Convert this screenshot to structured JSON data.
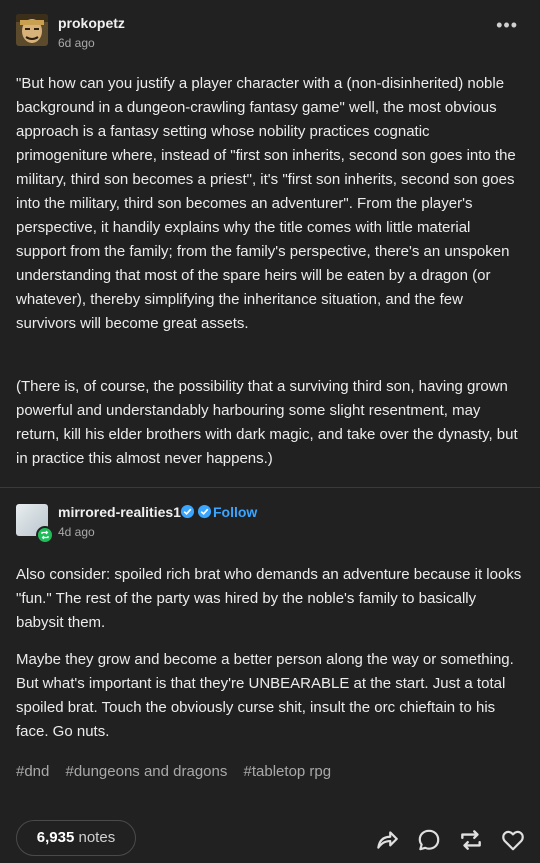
{
  "post": {
    "username": "prokopetz",
    "time": "6d ago",
    "paragraphs": [
      "\"But how can you justify a player character with a (non-disinherited) noble background in a dungeon-crawling fantasy game\" well, the most obvious approach is a fantasy setting whose nobility practices cognatic primogeniture where, instead of \"first son inherits, second son goes into the military, third son becomes a priest\", it's \"first son inherits, second son goes into the military, third son becomes an adventurer\". From the player's perspective, it handily explains why the title comes with little material support from the family; from the family's perspective, there's an unspoken understanding that most of the spare heirs will be eaten by a dragon (or whatever), thereby simplifying the inheritance situation, and the few survivors will become great assets.",
      "(There is, of course, the possibility that a surviving third son, having grown powerful and understandably harbouring some slight resentment, may return, kill his elder brothers with dark magic, and take over the dynasty, but in practice this almost never happens.)"
    ]
  },
  "reblog": {
    "username": "mirrored-realities1",
    "follow_label": "Follow",
    "time": "4d ago",
    "paragraphs": [
      "Also consider: spoiled rich brat who demands an adventure because it looks \"fun.\" The rest of the party was hired by the noble's family to basically babysit them.",
      "Maybe they grow and become a better person along the way or something. But what's important is that they're UNBEARABLE at the start. Just a total spoiled brat. Touch the obviously curse shit, insult the orc chieftain to his face. Go nuts."
    ]
  },
  "tags": [
    "#dnd",
    "#dungeons and dragons",
    "#tabletop rpg"
  ],
  "footer": {
    "notes_count": "6,935",
    "notes_label": "notes"
  },
  "colors": {
    "background": "#212121",
    "link": "#3aa6ff",
    "reblog_badge": "#1fbd5a"
  },
  "icons": [
    "more-icon",
    "verified-icon",
    "reblog-badge-icon",
    "share-icon",
    "reply-icon",
    "reblog-icon",
    "like-icon"
  ]
}
